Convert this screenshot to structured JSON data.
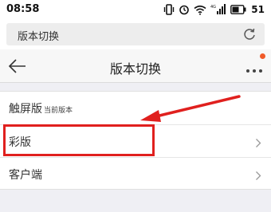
{
  "status_bar": {
    "time": "08:58",
    "battery": "51"
  },
  "url_bar": {
    "title": "版本切换",
    "refresh_icon": "refresh-icon"
  },
  "nav_bar": {
    "title": "版本切换",
    "back_icon": "back-arrow-icon",
    "more_icon": "more-icon",
    "notification_dot_color": "#f05a28"
  },
  "list": {
    "items": [
      {
        "label": "触屏版",
        "sub": "当前版本"
      },
      {
        "label": "彩版"
      },
      {
        "label": "客户端"
      }
    ]
  },
  "annotation": {
    "color": "#e0201e",
    "shapes": [
      "highlight-box",
      "pointer-arrow"
    ]
  }
}
